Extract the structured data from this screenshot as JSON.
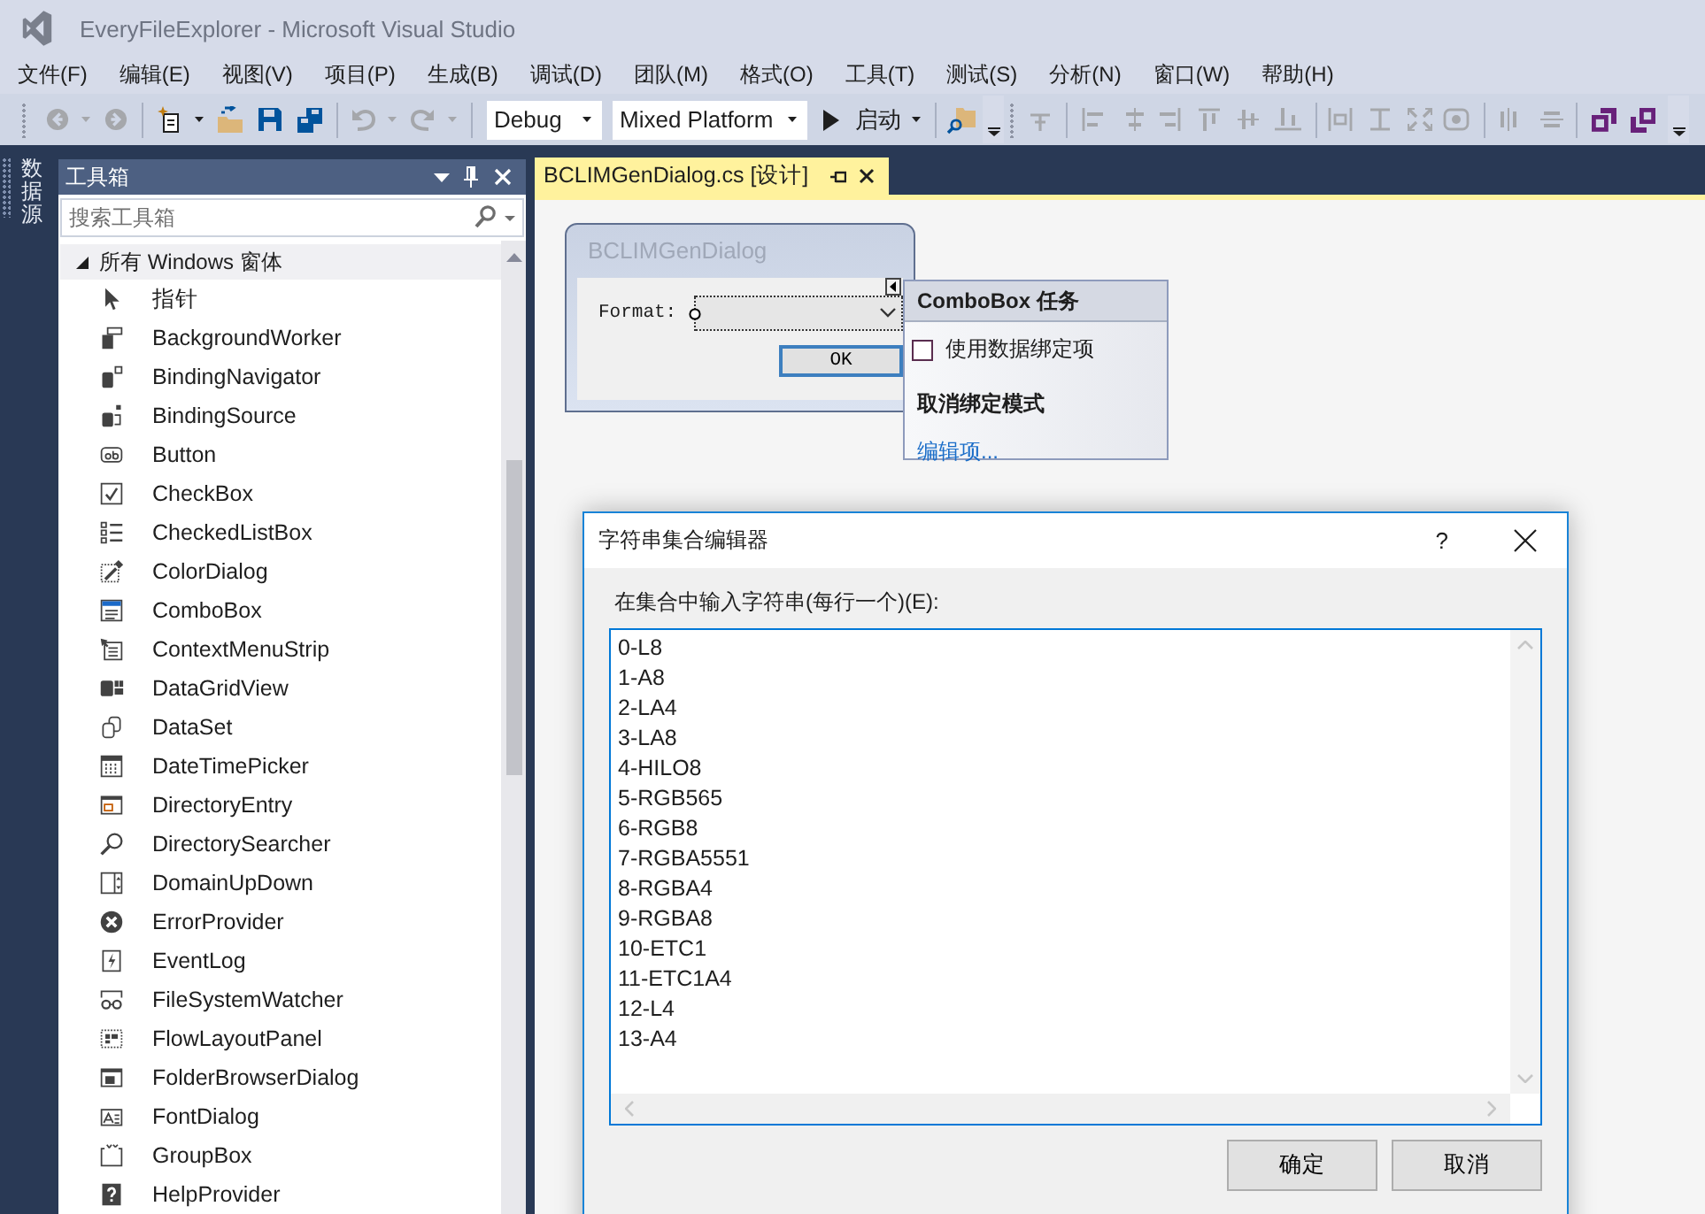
{
  "window": {
    "title": "EveryFileExplorer - Microsoft Visual Studio"
  },
  "menu": [
    "文件(F)",
    "编辑(E)",
    "视图(V)",
    "项目(P)",
    "生成(B)",
    "调试(D)",
    "团队(M)",
    "格式(O)",
    "工具(T)",
    "测试(S)",
    "分析(N)",
    "窗口(W)",
    "帮助(H)"
  ],
  "toolbar": {
    "navigation": {
      "disabled": true
    },
    "history": {
      "disabled": true
    },
    "configuration": {
      "value": "Debug"
    },
    "platform": {
      "value": "Mixed Platform"
    },
    "start": {
      "label": "启动"
    },
    "layout": {
      "disabled": true
    }
  },
  "side_tab": {
    "label": "数据源"
  },
  "toolbox": {
    "title": "工具箱",
    "search": {
      "placeholder": "搜索工具箱"
    },
    "group": {
      "label": "所有 Windows 窗体",
      "expanded": true,
      "children": [
        {
          "label": "指针"
        },
        {
          "label": "BackgroundWorker"
        },
        {
          "label": "BindingNavigator"
        },
        {
          "label": "BindingSource"
        },
        {
          "label": "Button"
        },
        {
          "label": "CheckBox"
        },
        {
          "label": "CheckedListBox"
        },
        {
          "label": "ColorDialog"
        },
        {
          "label": "ComboBox"
        },
        {
          "label": "ContextMenuStrip"
        },
        {
          "label": "DataGridView"
        },
        {
          "label": "DataSet"
        },
        {
          "label": "DateTimePicker"
        },
        {
          "label": "DirectoryEntry"
        },
        {
          "label": "DirectorySearcher"
        },
        {
          "label": "DomainUpDown"
        },
        {
          "label": "ErrorProvider"
        },
        {
          "label": "EventLog"
        },
        {
          "label": "FileSystemWatcher"
        },
        {
          "label": "FlowLayoutPanel"
        },
        {
          "label": "FolderBrowserDialog"
        },
        {
          "label": "FontDialog"
        },
        {
          "label": "GroupBox"
        },
        {
          "label": "HelpProvider"
        }
      ]
    }
  },
  "document_tab": {
    "label": "BCLIMGenDialog.cs [设计]",
    "selected": true
  },
  "form_preview": {
    "title": "BCLIMGenDialog",
    "field_label": "Format:",
    "button": "OK"
  },
  "smart_tag": {
    "title": "ComboBox 任务",
    "checkbox": {
      "label": "使用数据绑定项",
      "checked": false
    },
    "section": "取消绑定模式",
    "link": "编辑项..."
  },
  "dialog": {
    "title": "字符串集合编辑器",
    "help": "?",
    "prompt": "在集合中输入字符串(每行一个)(E):",
    "lines": [
      "0-L8",
      "1-A8",
      "2-LA4",
      "3-LA8",
      "4-HILO8",
      "5-RGB565",
      "6-RGB8",
      "7-RGBA5551",
      "8-RGBA4",
      "9-RGBA8",
      "10-ETC1",
      "11-ETC1A4",
      "12-L4",
      "13-A4"
    ],
    "buttons": [
      {
        "label": "确定"
      },
      {
        "label": "取消"
      }
    ]
  }
}
